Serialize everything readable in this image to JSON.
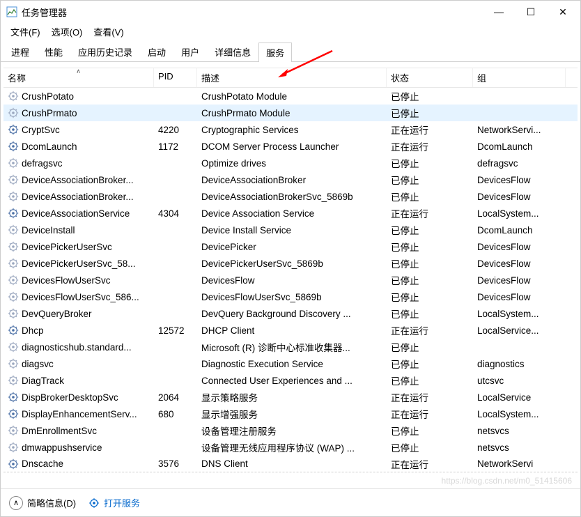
{
  "titlebar": {
    "title": "任务管理器"
  },
  "menubar": {
    "items": [
      "文件(F)",
      "选项(O)",
      "查看(V)"
    ]
  },
  "tabs": {
    "items": [
      "进程",
      "性能",
      "应用历史记录",
      "启动",
      "用户",
      "详细信息",
      "服务"
    ],
    "active": 6
  },
  "columns": {
    "name": "名称",
    "pid": "PID",
    "desc": "描述",
    "status": "状态",
    "group": "组"
  },
  "rows": [
    {
      "name": "CrushPotato",
      "pid": "",
      "desc": "CrushPotato Module",
      "status": "已停止",
      "group": "",
      "stopped": true
    },
    {
      "name": "CrushPrmato",
      "pid": "",
      "desc": "CrushPrmato Module",
      "status": "已停止",
      "group": "",
      "stopped": true,
      "selected": true
    },
    {
      "name": "CryptSvc",
      "pid": "4220",
      "desc": "Cryptographic Services",
      "status": "正在运行",
      "group": "NetworkServi..."
    },
    {
      "name": "DcomLaunch",
      "pid": "1172",
      "desc": "DCOM Server Process Launcher",
      "status": "正在运行",
      "group": "DcomLaunch"
    },
    {
      "name": "defragsvc",
      "pid": "",
      "desc": "Optimize drives",
      "status": "已停止",
      "group": "defragsvc",
      "stopped": true
    },
    {
      "name": "DeviceAssociationBroker...",
      "pid": "",
      "desc": "DeviceAssociationBroker",
      "status": "已停止",
      "group": "DevicesFlow",
      "stopped": true
    },
    {
      "name": "DeviceAssociationBroker...",
      "pid": "",
      "desc": "DeviceAssociationBrokerSvc_5869b",
      "status": "已停止",
      "group": "DevicesFlow",
      "stopped": true
    },
    {
      "name": "DeviceAssociationService",
      "pid": "4304",
      "desc": "Device Association Service",
      "status": "正在运行",
      "group": "LocalSystem..."
    },
    {
      "name": "DeviceInstall",
      "pid": "",
      "desc": "Device Install Service",
      "status": "已停止",
      "group": "DcomLaunch",
      "stopped": true
    },
    {
      "name": "DevicePickerUserSvc",
      "pid": "",
      "desc": "DevicePicker",
      "status": "已停止",
      "group": "DevicesFlow",
      "stopped": true
    },
    {
      "name": "DevicePickerUserSvc_58...",
      "pid": "",
      "desc": "DevicePickerUserSvc_5869b",
      "status": "已停止",
      "group": "DevicesFlow",
      "stopped": true
    },
    {
      "name": "DevicesFlowUserSvc",
      "pid": "",
      "desc": "DevicesFlow",
      "status": "已停止",
      "group": "DevicesFlow",
      "stopped": true
    },
    {
      "name": "DevicesFlowUserSvc_586...",
      "pid": "",
      "desc": "DevicesFlowUserSvc_5869b",
      "status": "已停止",
      "group": "DevicesFlow",
      "stopped": true
    },
    {
      "name": "DevQueryBroker",
      "pid": "",
      "desc": "DevQuery Background Discovery ...",
      "status": "已停止",
      "group": "LocalSystem...",
      "stopped": true
    },
    {
      "name": "Dhcp",
      "pid": "12572",
      "desc": "DHCP Client",
      "status": "正在运行",
      "group": "LocalService..."
    },
    {
      "name": "diagnosticshub.standard...",
      "pid": "",
      "desc": "Microsoft (R) 诊断中心标准收集器...",
      "status": "已停止",
      "group": "",
      "stopped": true
    },
    {
      "name": "diagsvc",
      "pid": "",
      "desc": "Diagnostic Execution Service",
      "status": "已停止",
      "group": "diagnostics",
      "stopped": true
    },
    {
      "name": "DiagTrack",
      "pid": "",
      "desc": "Connected User Experiences and ...",
      "status": "已停止",
      "group": "utcsvc",
      "stopped": true
    },
    {
      "name": "DispBrokerDesktopSvc",
      "pid": "2064",
      "desc": "显示策略服务",
      "status": "正在运行",
      "group": "LocalService"
    },
    {
      "name": "DisplayEnhancementServ...",
      "pid": "680",
      "desc": "显示增强服务",
      "status": "正在运行",
      "group": "LocalSystem..."
    },
    {
      "name": "DmEnrollmentSvc",
      "pid": "",
      "desc": "设备管理注册服务",
      "status": "已停止",
      "group": "netsvcs",
      "stopped": true
    },
    {
      "name": "dmwappushservice",
      "pid": "",
      "desc": "设备管理无线应用程序协议 (WAP) ...",
      "status": "已停止",
      "group": "netsvcs",
      "stopped": true
    },
    {
      "name": "Dnscache",
      "pid": "3576",
      "desc": "DNS Client",
      "status": "正在运行",
      "group": "NetworkServi"
    }
  ],
  "footer": {
    "fewerDetails": "简略信息(D)",
    "openServices": "打开服务"
  },
  "watermark": "https://blog.csdn.net/m0_51415606"
}
